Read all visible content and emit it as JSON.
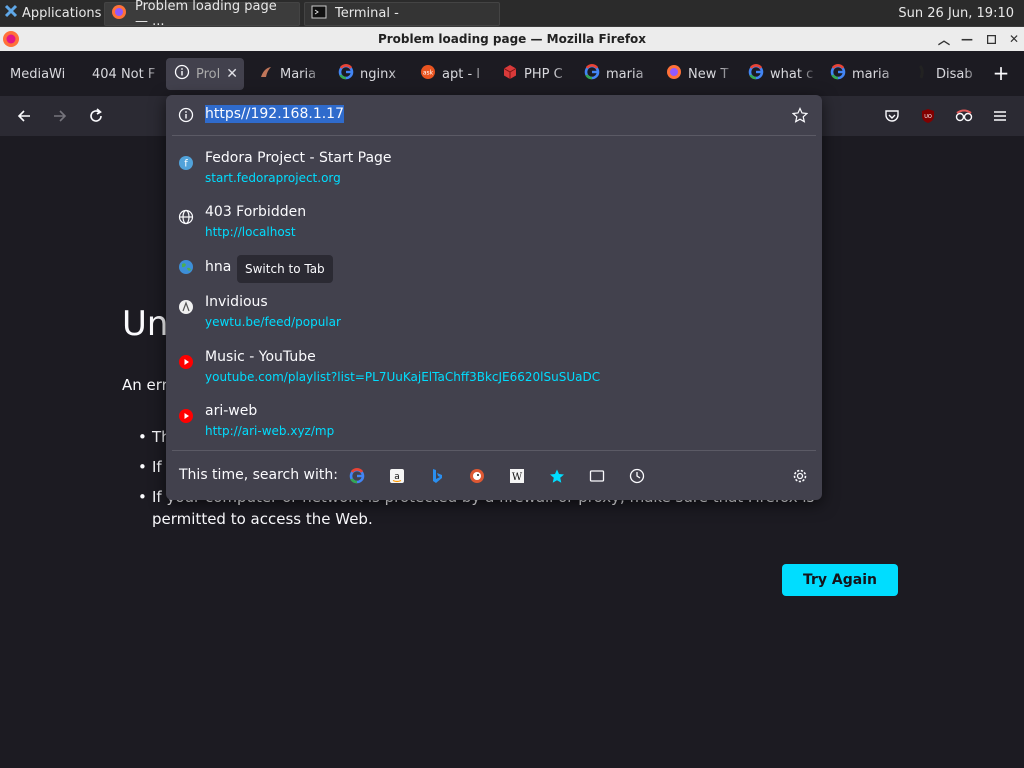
{
  "taskbar": {
    "apps_label": "Applications",
    "tasks": [
      {
        "label": "Problem loading page — ...",
        "icon": "firefox-icon"
      },
      {
        "label": "Terminal -",
        "icon": "terminal-icon"
      }
    ],
    "clock": "Sun 26 Jun, 19:10"
  },
  "window": {
    "title": "Problem loading page — Mozilla Firefox"
  },
  "tabs": [
    {
      "label": "MediaWi",
      "icon": "",
      "selected": false
    },
    {
      "label": "404 Not F",
      "icon": "",
      "selected": false
    },
    {
      "label": "Prol",
      "icon": "info-icon",
      "selected": true
    },
    {
      "label": "Maria",
      "icon": "mariadb-icon",
      "selected": false
    },
    {
      "label": "nginx",
      "icon": "google-icon",
      "selected": false
    },
    {
      "label": "apt - I",
      "icon": "askubuntu-icon",
      "selected": false
    },
    {
      "label": "PHP C",
      "icon": "php-cube-icon",
      "selected": false
    },
    {
      "label": "maria",
      "icon": "google-icon",
      "selected": false
    },
    {
      "label": "New T",
      "icon": "firefox-icon",
      "selected": false
    },
    {
      "label": "what c",
      "icon": "google-icon",
      "selected": false
    },
    {
      "label": "maria",
      "icon": "google-icon",
      "selected": false
    },
    {
      "label": "Disab",
      "icon": "disable-icon",
      "selected": false
    }
  ],
  "urlbar": {
    "value_selected": "https",
    "value_rest": "//192.168.1.17"
  },
  "results": [
    {
      "title": "Fedora Project - Start Page",
      "url": "start.fedoraproject.org",
      "icon": "fedora-icon"
    },
    {
      "title": "403 Forbidden",
      "url": "http://localhost",
      "icon": "globe-icon"
    },
    {
      "title": "hna",
      "url": "",
      "icon": "earth-icon",
      "action": "Switch to Tab"
    },
    {
      "title": "Invidious",
      "url": "yewtu.be/feed/popular",
      "icon": "invidious-icon"
    },
    {
      "title": "Music - YouTube",
      "url": "youtube.com/playlist?list=PL7UuKajElTaChff3BkcJE6620lSuSUaDC",
      "icon": "youtube-icon"
    },
    {
      "title": "ari-web",
      "url": "http://ari-web.xyz/mp",
      "icon": "youtube-icon"
    }
  ],
  "search_with_label": "This time, search with:",
  "page": {
    "title": "Un",
    "desc": "An err",
    "bullets": [
      "Th",
      "If",
      "If your computer or network is protected by a firewall or proxy, make sure that Firefox is permitted to access the Web."
    ],
    "try_again": "Try Again"
  },
  "colors": {
    "accent": "#00ddff",
    "panel": "#42414d",
    "background": "#1c1b22"
  }
}
